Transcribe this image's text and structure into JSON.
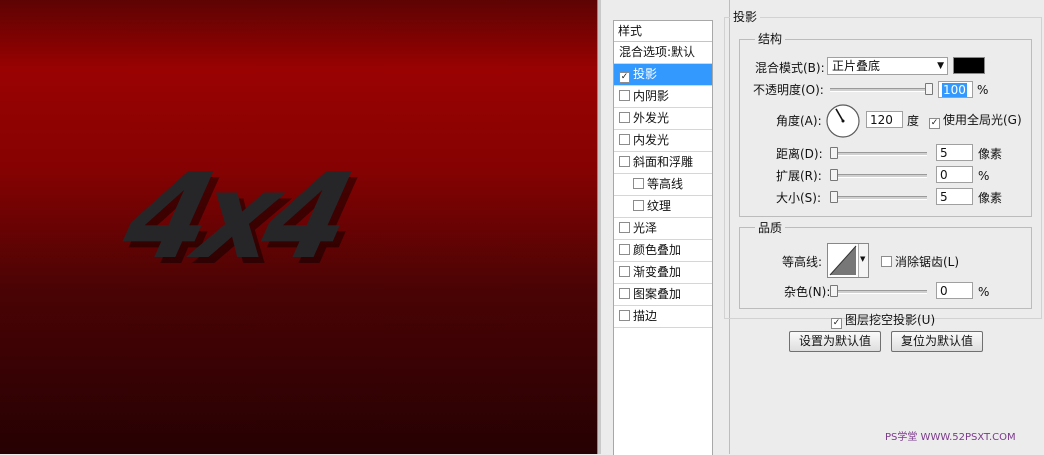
{
  "canvas": {
    "logo_text": "4x4"
  },
  "styles_panel": {
    "header": "样式",
    "items": [
      {
        "label": "混合选项:默认",
        "checkbox": false,
        "checked": false,
        "selected": false,
        "indent": false
      },
      {
        "label": "投影",
        "checkbox": true,
        "checked": true,
        "selected": true,
        "indent": false
      },
      {
        "label": "内阴影",
        "checkbox": true,
        "checked": false,
        "selected": false,
        "indent": false
      },
      {
        "label": "外发光",
        "checkbox": true,
        "checked": false,
        "selected": false,
        "indent": false
      },
      {
        "label": "内发光",
        "checkbox": true,
        "checked": false,
        "selected": false,
        "indent": false
      },
      {
        "label": "斜面和浮雕",
        "checkbox": true,
        "checked": false,
        "selected": false,
        "indent": false
      },
      {
        "label": "等高线",
        "checkbox": true,
        "checked": false,
        "selected": false,
        "indent": true
      },
      {
        "label": "纹理",
        "checkbox": true,
        "checked": false,
        "selected": false,
        "indent": true
      },
      {
        "label": "光泽",
        "checkbox": true,
        "checked": false,
        "selected": false,
        "indent": false
      },
      {
        "label": "颜色叠加",
        "checkbox": true,
        "checked": false,
        "selected": false,
        "indent": false
      },
      {
        "label": "渐变叠加",
        "checkbox": true,
        "checked": false,
        "selected": false,
        "indent": false
      },
      {
        "label": "图案叠加",
        "checkbox": true,
        "checked": false,
        "selected": false,
        "indent": false
      },
      {
        "label": "描边",
        "checkbox": true,
        "checked": false,
        "selected": false,
        "indent": false
      }
    ]
  },
  "drop_shadow": {
    "title": "投影",
    "structure": {
      "legend": "结构",
      "blend_mode_label": "混合模式(B):",
      "blend_mode_value": "正片叠底",
      "shadow_color": "#000000",
      "opacity_label": "不透明度(O):",
      "opacity_value": "100",
      "opacity_unit": "%",
      "opacity_level": 1.0,
      "angle_label": "角度(A):",
      "angle_value": "120",
      "angle_unit": "度",
      "global_light_label": "使用全局光(G)",
      "global_light_checked": true,
      "distance_label": "距离(D):",
      "distance_value": "5",
      "distance_unit": "像素",
      "spread_label": "扩展(R):",
      "spread_value": "0",
      "spread_unit": "%",
      "size_label": "大小(S):",
      "size_value": "5",
      "size_unit": "像素"
    },
    "quality": {
      "legend": "品质",
      "contour_label": "等高线:",
      "antialias_label": "消除锯齿(L)",
      "antialias_checked": false,
      "noise_label": "杂色(N):",
      "noise_value": "0",
      "noise_unit": "%"
    },
    "knockout_label": "图层挖空投影(U)",
    "knockout_checked": true,
    "make_default_button": "设置为默认值",
    "reset_default_button": "复位为默认值"
  },
  "watermark": "PS学堂 WWW.52PSXT.COM"
}
